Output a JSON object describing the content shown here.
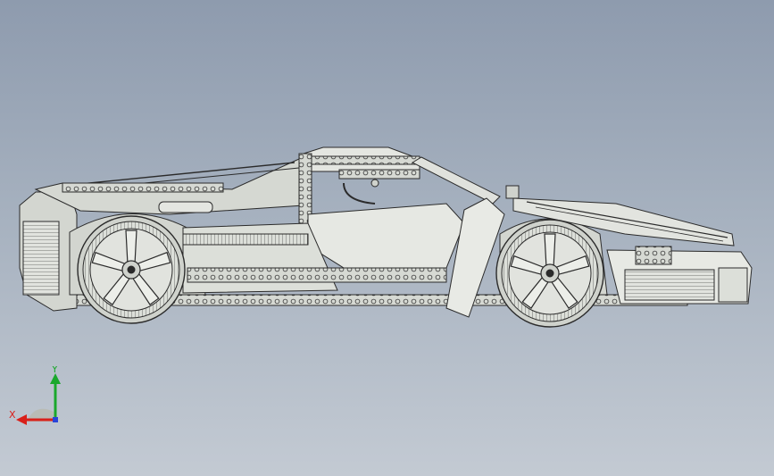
{
  "viewport": {
    "background_top": "#8e9bae",
    "background_bottom": "#c3cad3"
  },
  "model": {
    "line_color": "#2b2b2b",
    "fill_color": "#d9dcd6",
    "highlight_color": "#eceee9",
    "shadow_color": "#b9bcb6"
  },
  "triad": {
    "x_label": "X",
    "y_label": "Y",
    "x_color": "#d9201a",
    "y_color": "#1aa82c",
    "z_color": "#2a44d8",
    "x_icon": "arrow-left-icon",
    "y_icon": "arrow-up-icon"
  }
}
